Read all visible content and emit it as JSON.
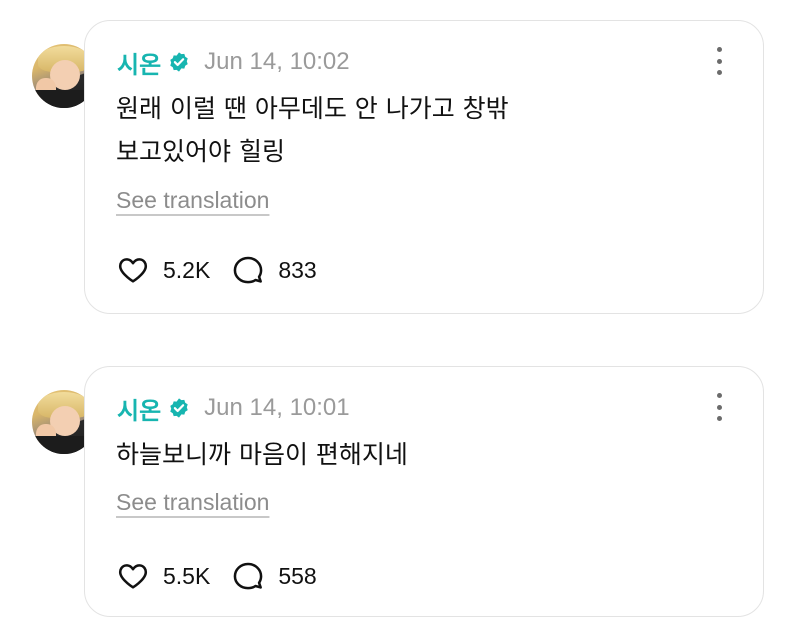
{
  "posts": [
    {
      "username": "시온",
      "timestamp": "Jun 14, 10:02",
      "text": "원래 이럴 땐 아무데도 안 나가고 창밖\n보고있어야 힐링",
      "translate_label": "See translation",
      "likes": "5.2K",
      "comments": "833"
    },
    {
      "username": "시온",
      "timestamp": "Jun 14, 10:01",
      "text": "하늘보니까 마음이 편해지네",
      "translate_label": "See translation",
      "likes": "5.5K",
      "comments": "558"
    }
  ],
  "icons": {
    "verified": "verified-badge-icon",
    "more": "more-vertical-icon",
    "like": "heart-icon",
    "comment": "comment-bubble-icon"
  },
  "colors": {
    "username": "#17b5b0",
    "verified": "#17b5b0",
    "timestamp": "#9a9a9a",
    "card_border": "#e3e3e3"
  }
}
